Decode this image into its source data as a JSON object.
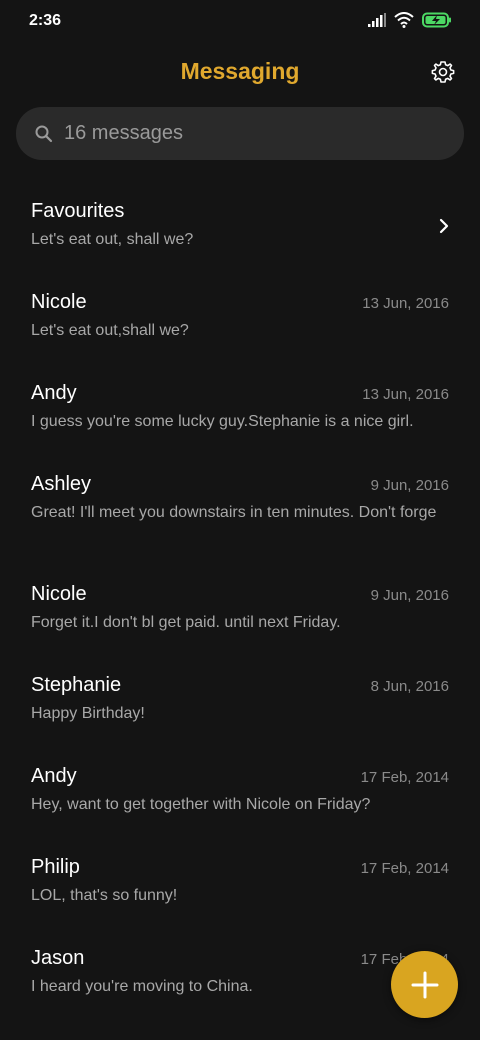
{
  "status_bar": {
    "time": "2:36",
    "icons": [
      "signal-icon",
      "wifi-icon",
      "battery-charging-icon"
    ],
    "battery_color": "#4cd964"
  },
  "header": {
    "title": "Messaging",
    "title_color": "#e0a82e",
    "settings_icon": "gear-icon"
  },
  "search": {
    "placeholder": "16 messages",
    "icon": "search-icon"
  },
  "favourites": {
    "name": "Favourites",
    "preview": "Let's eat out, shall we?",
    "icon": "chevron-right-icon"
  },
  "conversations": [
    {
      "name": "Nicole",
      "date": "13 Jun, 2016",
      "preview": "Let's eat out,shall we?"
    },
    {
      "name": "Andy",
      "date": "13 Jun, 2016",
      "preview": "I guess you're some lucky guy.Stephanie is a nice girl."
    },
    {
      "name": "Ashley",
      "date": "9 Jun, 2016",
      "preview": "Great! I'll meet you downstairs in ten minutes. Don't forge"
    },
    {
      "name": "Nicole",
      "date": "9 Jun, 2016",
      "preview": "Forget it.I don't bl get paid. until next Friday."
    },
    {
      "name": "Stephanie",
      "date": "8 Jun, 2016",
      "preview": "Happy Birthday!"
    },
    {
      "name": "Andy",
      "date": "17 Feb, 2014",
      "preview": "Hey, want to get together with Nicole on Friday?"
    },
    {
      "name": "Philip",
      "date": "17 Feb, 2014",
      "preview": "LOL, that's so funny!"
    },
    {
      "name": "Jason",
      "date": "17 Feb, 2014",
      "preview": "I heard you're moving to China."
    }
  ],
  "fab": {
    "icon": "plus-icon",
    "color": "#d9a520"
  }
}
